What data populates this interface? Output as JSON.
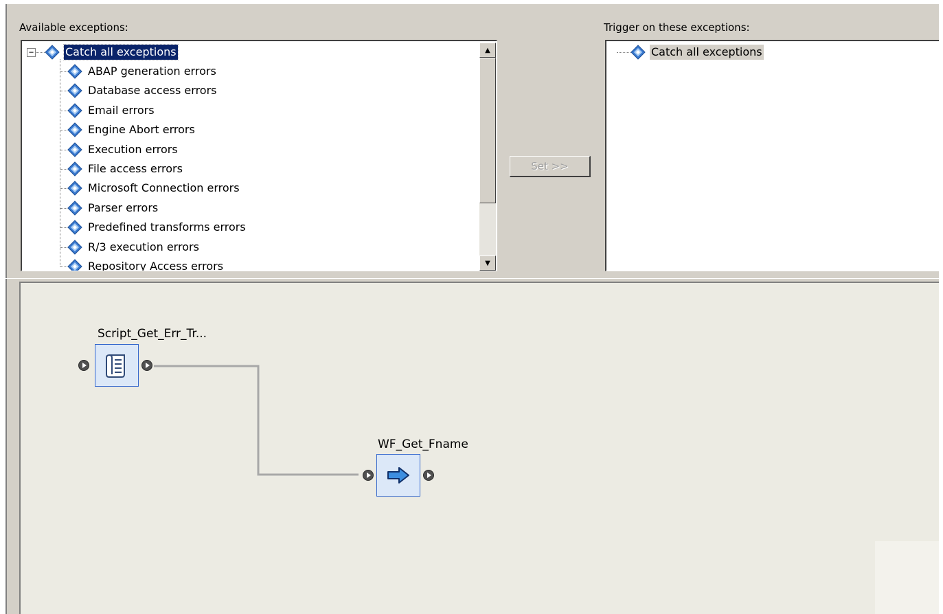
{
  "available": {
    "label": "Available exceptions:",
    "root": "Catch all exceptions",
    "items": [
      "ABAP generation errors",
      "Database access errors",
      "Email errors",
      "Engine Abort errors",
      "Execution errors",
      "File access errors",
      "Microsoft Connection errors",
      "Parser errors",
      "Predefined transforms errors",
      "R/3 execution errors",
      "Repository Access errors"
    ]
  },
  "set_button": {
    "label": "Set >>"
  },
  "trigger": {
    "label": "Trigger on these exceptions:",
    "items": [
      "Catch all exceptions"
    ]
  },
  "workflow": {
    "nodes": [
      {
        "name": "Script_Get_Err_Tr...",
        "icon": "script-icon"
      },
      {
        "name": "WF_Get_Fname",
        "icon": "workflow-arrow-icon"
      }
    ]
  },
  "colors": {
    "selection": "#0a246a",
    "node_fill": "#dce8f8",
    "node_border": "#3366cc",
    "canvas": "#ecebe3"
  }
}
